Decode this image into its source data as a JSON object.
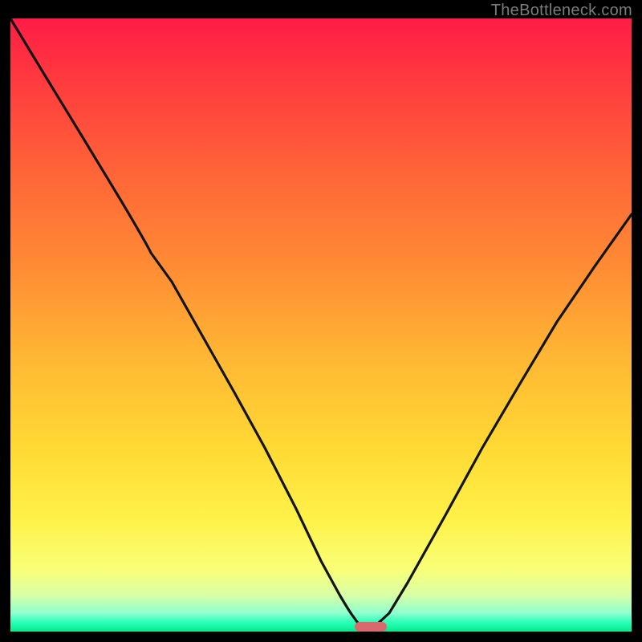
{
  "watermark": "TheBottleneck.com",
  "colors": {
    "top": "#ff1c46",
    "mid_orange": "#ff8a34",
    "yellow": "#fff24a",
    "green": "#06e98d",
    "curve_stroke": "#141414",
    "marker": "#d86a6f",
    "frame": "#000000"
  },
  "marker": {
    "x_frac": 0.58,
    "y_frac": 0.996,
    "label": "bottleneck-marker"
  },
  "chart_data": {
    "type": "line",
    "title": "",
    "xlabel": "",
    "ylabel": "",
    "xlim": [
      0,
      1
    ],
    "ylim": [
      0,
      1
    ],
    "legend": null,
    "grid": false,
    "note": "Axes unlabeled in source image; x and y expressed as fractions of the plot area (0 at left/bottom, 1 at right/top). Curve read visually from rendered image.",
    "series": [
      {
        "name": "bottleneck-curve",
        "x": [
          0.0,
          0.06,
          0.12,
          0.18,
          0.226,
          0.26,
          0.31,
          0.36,
          0.41,
          0.46,
          0.5,
          0.53,
          0.552,
          0.565,
          0.58,
          0.61,
          0.64,
          0.7,
          0.76,
          0.82,
          0.88,
          0.94,
          1.0
        ],
        "y": [
          1.0,
          0.9,
          0.8,
          0.7,
          0.618,
          0.57,
          0.48,
          0.39,
          0.3,
          0.2,
          0.115,
          0.06,
          0.025,
          0.008,
          0.002,
          0.03,
          0.08,
          0.19,
          0.3,
          0.405,
          0.505,
          0.595,
          0.68
        ]
      }
    ],
    "annotations": [
      {
        "type": "pill-marker",
        "x": 0.58,
        "y": 0.002,
        "color": "#d86a6f"
      }
    ]
  }
}
